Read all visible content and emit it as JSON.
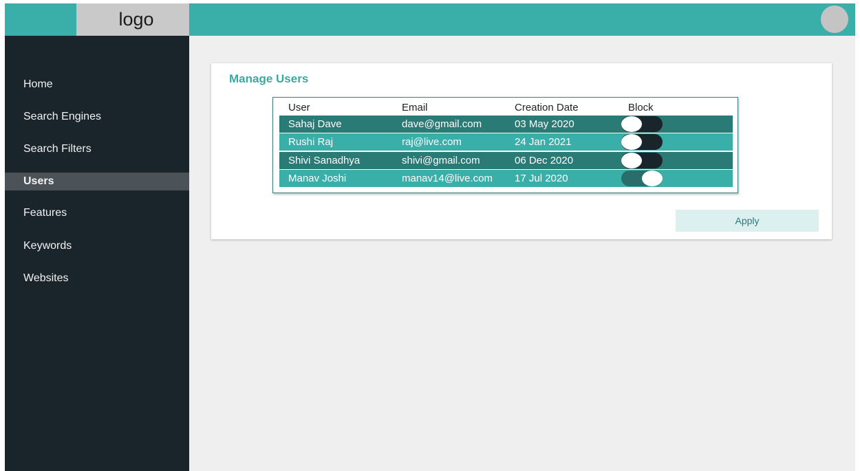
{
  "header": {
    "logo_text": "logo"
  },
  "sidebar": {
    "items": [
      {
        "label": "Home"
      },
      {
        "label": "Search Engines"
      },
      {
        "label": "Search Filters"
      },
      {
        "label": "Users",
        "active": true
      },
      {
        "label": "Features"
      },
      {
        "label": "Keywords"
      },
      {
        "label": "Websites"
      }
    ]
  },
  "main": {
    "title": "Manage Users",
    "table": {
      "columns": [
        "User",
        "Email",
        "Creation Date",
        "Block"
      ],
      "rows": [
        {
          "user": "Sahaj Dave",
          "email": "dave@gmail.com",
          "created": "03 May 2020",
          "blocked": false
        },
        {
          "user": "Rushi Raj",
          "email": "raj@live.com",
          "created": "24 Jan 2021",
          "blocked": false
        },
        {
          "user": "Shivi Sanadhya",
          "email": "shivi@gmail.com",
          "created": "06 Dec 2020",
          "blocked": false
        },
        {
          "user": "Manav Joshi",
          "email": "manav14@live.com",
          "created": "17 Jul 2020",
          "blocked": true
        }
      ]
    },
    "apply_label": "Apply"
  },
  "colors": {
    "accent": "#3aafa9",
    "accent_dark": "#2a7a76",
    "sidebar_bg": "#1a252b",
    "sidebar_active": "#4b5359",
    "title": "#3aa9a4"
  }
}
